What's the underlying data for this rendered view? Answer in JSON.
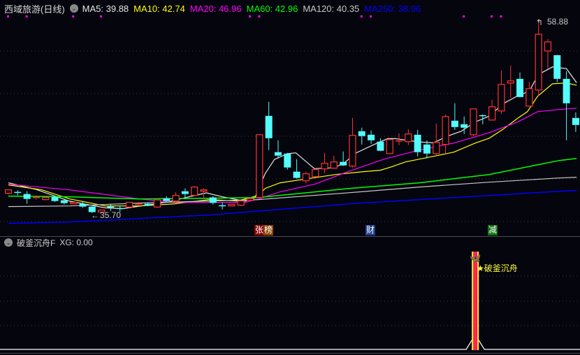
{
  "header": {
    "title": "西域旅游(日线)",
    "ma_labels": [
      {
        "text": "MA5: 39.88",
        "color": "#e8e8e8"
      },
      {
        "text": "MA10: 42.74",
        "color": "#ffff00"
      },
      {
        "text": "MA20: 46.96",
        "color": "#ff00ff"
      },
      {
        "text": "MA60: 42.96",
        "color": "#00ff00"
      },
      {
        "text": "MA120: 40.35",
        "color": "#c8c8c8"
      },
      {
        "text": "MA250: 38.96",
        "color": "#0000ff"
      }
    ]
  },
  "annotations": {
    "high_label": "58.88",
    "low_label": "35.70"
  },
  "tags": [
    {
      "text": "张",
      "color": "#8b0000"
    },
    {
      "text": "榜",
      "color": "#8b4500"
    },
    {
      "text": "财",
      "color": "#1c3f8a"
    },
    {
      "text": "减",
      "color": "#107010"
    }
  ],
  "sub_panel": {
    "title": "破釜沉舟F",
    "value": "XG: 0.00",
    "signal_text": "★破釜沉舟"
  },
  "colors": {
    "up": "#ff3232",
    "down": "#54fcfc",
    "grid": "#3a3a44",
    "dot": "#ff00ff"
  },
  "chart_data": {
    "type": "candlestick",
    "ylim": [
      32.9,
      59.55
    ],
    "candles": [
      [
        38.04,
        38.5,
        37.9,
        38.46
      ],
      [
        38.15,
        38.4,
        37.8,
        38.1
      ],
      [
        37.96,
        38.29,
        36.79,
        37.37
      ],
      [
        37.45,
        37.8,
        37.3,
        37.54
      ],
      [
        37.29,
        37.6,
        37.2,
        37.54
      ],
      [
        37.63,
        37.7,
        37.0,
        37.12
      ],
      [
        37.21,
        37.4,
        36.7,
        36.87
      ],
      [
        36.79,
        37.0,
        36.75,
        36.96
      ],
      [
        36.79,
        37.0,
        36.3,
        36.45
      ],
      [
        36.45,
        36.5,
        35.7,
        35.79
      ],
      [
        35.79,
        36.1,
        35.75,
        36.04
      ],
      [
        36.4,
        36.8,
        35.9,
        36.35
      ],
      [
        36.22,
        36.6,
        35.8,
        36.18
      ],
      [
        36.4,
        37.0,
        36.3,
        36.96
      ],
      [
        36.68,
        37.0,
        36.55,
        36.75
      ],
      [
        36.79,
        36.95,
        36.5,
        36.55
      ],
      [
        36.4,
        37.3,
        36.3,
        37.25
      ],
      [
        37.45,
        37.7,
        36.95,
        37.12
      ],
      [
        37.12,
        38.2,
        37.0,
        37.79
      ],
      [
        38.29,
        38.63,
        37.37,
        37.96
      ],
      [
        37.79,
        38.9,
        37.7,
        38.8
      ],
      [
        38.3,
        38.63,
        37.54,
        38.46
      ],
      [
        37.55,
        37.7,
        36.7,
        36.9
      ],
      [
        36.55,
        36.95,
        36.1,
        36.5
      ],
      [
        36.53,
        36.75,
        36.5,
        36.71
      ],
      [
        36.62,
        37.2,
        36.5,
        37.12
      ],
      [
        37.2,
        37.6,
        37.1,
        37.4
      ],
      [
        37.54,
        45.07,
        37.5,
        45.07
      ],
      [
        47.33,
        49.01,
        43.23,
        44.65
      ],
      [
        42.98,
        44.4,
        42.23,
        42.56
      ],
      [
        42.81,
        42.9,
        40.89,
        41.14
      ],
      [
        40.64,
        42.14,
        39.8,
        39.89
      ],
      [
        39.55,
        40.64,
        39.22,
        40.39
      ],
      [
        40.05,
        41.0,
        40.0,
        40.89
      ],
      [
        40.97,
        42.9,
        40.47,
        41.64
      ],
      [
        41.06,
        42.56,
        41.0,
        41.81
      ],
      [
        41.81,
        43.06,
        41.31,
        41.39
      ],
      [
        41.31,
        47.08,
        41.14,
        44.99
      ],
      [
        45.49,
        45.91,
        43.9,
        44.91
      ],
      [
        45.07,
        45.57,
        43.98,
        44.4
      ],
      [
        44.24,
        44.65,
        43.1,
        43.15
      ],
      [
        42.81,
        44.57,
        42.75,
        44.49
      ],
      [
        44.24,
        45.24,
        43.82,
        44.32
      ],
      [
        44.24,
        45.74,
        43.82,
        45.16
      ],
      [
        45.07,
        45.66,
        42.48,
        42.98
      ],
      [
        43.9,
        44.4,
        42.23,
        42.81
      ],
      [
        42.81,
        46.41,
        42.65,
        44.15
      ],
      [
        43.9,
        47.5,
        42.81,
        47.25
      ],
      [
        46.75,
        48.84,
        45.66,
        45.99
      ],
      [
        46.33,
        47.25,
        45.16,
        45.91
      ],
      [
        45.07,
        48.2,
        44.91,
        48.17
      ],
      [
        47.35,
        47.5,
        46.33,
        47.3
      ],
      [
        46.83,
        49.26,
        46.8,
        48.42
      ],
      [
        47.92,
        52.77,
        47.58,
        51.1
      ],
      [
        51.27,
        53.36,
        49.51,
        51.52
      ],
      [
        51.77,
        52.52,
        49.55,
        49.59
      ],
      [
        48.5,
        51.43,
        48.45,
        50.6
      ],
      [
        50.43,
        58.88,
        49.68,
        57.12
      ],
      [
        55.11,
        56.54,
        53.02,
        56.2
      ],
      [
        54.61,
        54.65,
        51.35,
        51.77
      ],
      [
        51.77,
        52.69,
        44.4,
        48.84
      ],
      [
        47.08,
        47.75,
        45.41,
        46.24
      ]
    ],
    "ma_series": [
      {
        "name": "MA5",
        "color": "#e8e8e8",
        "points": [
          [
            0,
            39.3
          ],
          [
            3,
            38.5
          ],
          [
            6.6,
            37.1
          ],
          [
            10.4,
            36.3
          ],
          [
            12.3,
            36.2
          ],
          [
            14.1,
            36.5
          ],
          [
            17.1,
            37.0
          ],
          [
            20.1,
            37.8
          ],
          [
            21.3,
            38.1
          ],
          [
            23.1,
            37.6
          ],
          [
            25.4,
            37.1
          ],
          [
            26.5,
            37.5
          ],
          [
            27.6,
            40.4
          ],
          [
            28.6,
            42.1
          ],
          [
            30.0,
            42.8
          ],
          [
            30.9,
            42.9
          ],
          [
            32.9,
            41.0
          ],
          [
            34.8,
            41.1
          ],
          [
            35.9,
            41.5
          ],
          [
            37.4,
            42.9
          ],
          [
            39.7,
            44.1
          ],
          [
            40.8,
            44.6
          ],
          [
            41.6,
            44.6
          ],
          [
            44.2,
            44.2
          ],
          [
            45.7,
            44.1
          ],
          [
            47.2,
            44.9
          ],
          [
            48.7,
            45.5
          ],
          [
            50.2,
            46.6
          ],
          [
            51.7,
            47.3
          ],
          [
            53.2,
            48.8
          ],
          [
            54.7,
            49.7
          ],
          [
            56.0,
            50.3
          ],
          [
            57.0,
            52.3
          ],
          [
            58.5,
            53.2
          ],
          [
            60.0,
            53.0
          ],
          [
            61.1,
            51.3
          ]
        ]
      },
      {
        "name": "MA10",
        "color": "#ffff00",
        "points": [
          [
            0,
            39.05
          ],
          [
            3.6,
            38.46
          ],
          [
            6.6,
            37.37
          ],
          [
            10.4,
            36.53
          ],
          [
            14.1,
            36.53
          ],
          [
            17.9,
            36.79
          ],
          [
            21.6,
            37.29
          ],
          [
            24.6,
            37.12
          ],
          [
            26.9,
            37.79
          ],
          [
            27.6,
            38.63
          ],
          [
            29.2,
            39.3
          ],
          [
            32.2,
            39.8
          ],
          [
            35.2,
            40.3
          ],
          [
            38.2,
            40.64
          ],
          [
            40.0,
            40.81
          ],
          [
            41.2,
            41.22
          ],
          [
            42.7,
            41.81
          ],
          [
            44.2,
            42.14
          ],
          [
            45.7,
            42.48
          ],
          [
            47.9,
            42.98
          ],
          [
            50.2,
            44.07
          ],
          [
            51.7,
            44.65
          ],
          [
            53.2,
            45.74
          ],
          [
            54.7,
            47.0
          ],
          [
            55.8,
            47.83
          ],
          [
            56.9,
            49.68
          ],
          [
            58.5,
            51.18
          ],
          [
            60.0,
            51.27
          ],
          [
            61.1,
            51.01
          ]
        ]
      },
      {
        "name": "MA20",
        "color": "#ff00ff",
        "points": [
          [
            0,
            39.13
          ],
          [
            6.6,
            38.46
          ],
          [
            14.1,
            37.37
          ],
          [
            17.9,
            36.96
          ],
          [
            21.6,
            36.96
          ],
          [
            25.4,
            36.96
          ],
          [
            26.9,
            37.37
          ],
          [
            29.2,
            38.21
          ],
          [
            32.9,
            39.13
          ],
          [
            36.7,
            40.72
          ],
          [
            40.4,
            42.14
          ],
          [
            44.2,
            43.23
          ],
          [
            47.9,
            44.07
          ],
          [
            51.7,
            45.32
          ],
          [
            54.7,
            46.58
          ],
          [
            56.9,
            47.83
          ],
          [
            59.2,
            48.09
          ],
          [
            61.1,
            48.25
          ]
        ]
      },
      {
        "name": "MA60",
        "color": "#00ff00",
        "points": [
          [
            0,
            37.71
          ],
          [
            6.6,
            37.63
          ],
          [
            14.1,
            37.37
          ],
          [
            21.6,
            37.45
          ],
          [
            26.9,
            37.54
          ],
          [
            30.7,
            37.96
          ],
          [
            36.7,
            38.63
          ],
          [
            44.2,
            39.3
          ],
          [
            51.7,
            40.3
          ],
          [
            59.2,
            41.98
          ],
          [
            61.1,
            42.23
          ]
        ]
      },
      {
        "name": "MA120",
        "color": "#c8c8c8",
        "points": [
          [
            0,
            36.45
          ],
          [
            6.6,
            36.53
          ],
          [
            14.1,
            36.87
          ],
          [
            21.6,
            37.12
          ],
          [
            26.9,
            37.29
          ],
          [
            36.7,
            38.12
          ],
          [
            44.2,
            38.8
          ],
          [
            51.7,
            39.38
          ],
          [
            59.2,
            39.88
          ],
          [
            61.1,
            39.97
          ]
        ]
      },
      {
        "name": "MA250",
        "color": "#0000ff",
        "points": [
          [
            0,
            34.44
          ],
          [
            6.6,
            34.61
          ],
          [
            14.1,
            35.03
          ],
          [
            21.6,
            35.45
          ],
          [
            29.2,
            36.12
          ],
          [
            36.7,
            36.79
          ],
          [
            44.2,
            37.29
          ],
          [
            51.7,
            37.79
          ],
          [
            59.2,
            38.29
          ],
          [
            61.1,
            38.38
          ]
        ]
      }
    ],
    "signal_marker_indices": [
      0,
      2,
      7,
      10,
      26,
      27,
      38,
      39,
      49,
      52,
      53
    ],
    "tag_indices": [
      26.5,
      38.5,
      51.5
    ],
    "xg_signal_index": 50.2,
    "xg_value": 0.0
  }
}
